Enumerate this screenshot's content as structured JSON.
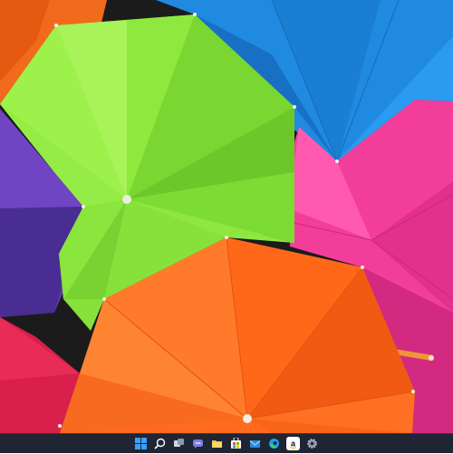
{
  "desktop": {
    "wallpaper": {
      "subject": "umbrellas-wallpaper",
      "colors": {
        "orange_top_left": "#f26a1b",
        "blue_top_right": "#1f8ae0",
        "green_center": "#86e23a",
        "purple_left": "#5a3aa8",
        "pink_right": "#f23e9a",
        "orange_bottom": "#ff6a1e",
        "red_bottom_left": "#d8204a"
      }
    }
  },
  "taskbar": {
    "background": "#1f2533",
    "items": [
      {
        "name": "start-button",
        "icon": "windows-logo-icon"
      },
      {
        "name": "search-button",
        "icon": "search-icon"
      },
      {
        "name": "task-view-button",
        "icon": "task-view-icon"
      },
      {
        "name": "teams-chat-button",
        "icon": "chat-icon"
      },
      {
        "name": "file-explorer-button",
        "icon": "folder-icon"
      },
      {
        "name": "microsoft-store-button",
        "icon": "store-icon"
      },
      {
        "name": "mail-button",
        "icon": "mail-icon"
      },
      {
        "name": "edge-browser-button",
        "icon": "edge-icon"
      },
      {
        "name": "amazon-app-button",
        "icon": "amazon-icon"
      },
      {
        "name": "settings-button",
        "icon": "gear-icon"
      }
    ]
  }
}
